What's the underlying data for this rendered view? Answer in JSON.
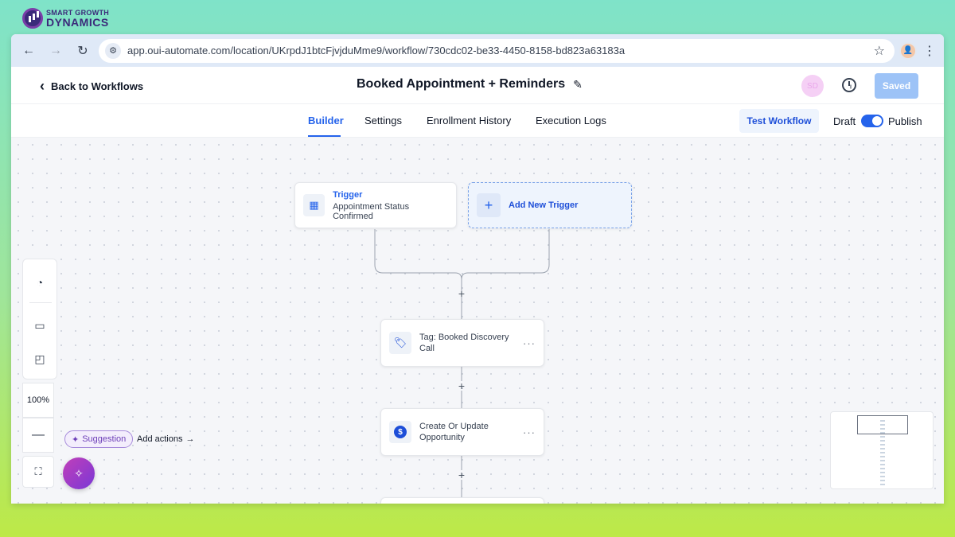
{
  "brand": {
    "top": "SMART GROWTH",
    "bottom": "DYNAMICS"
  },
  "browser": {
    "url": "app.oui-automate.com/location/UKrpdJ1btcFjvjduMme9/workflow/730cdc02-be33-4450-8158-bd823a63183a"
  },
  "header": {
    "back_label": "Back to Workflows",
    "title": "Booked Appointment + Reminders",
    "user_initials": "SD",
    "saved_label": "Saved"
  },
  "tabs": [
    {
      "label": "Builder",
      "active": true
    },
    {
      "label": "Settings",
      "active": false
    },
    {
      "label": "Enrollment History",
      "active": false
    },
    {
      "label": "Execution Logs",
      "active": false
    }
  ],
  "toolbar": {
    "test_label": "Test Workflow",
    "draft_label": "Draft",
    "publish_label": "Publish",
    "published_toggle": true
  },
  "canvas": {
    "trigger": {
      "title": "Trigger",
      "subtitle": "Appointment Status Confirmed"
    },
    "add_trigger_label": "Add New Trigger",
    "actions": [
      {
        "label": "Tag: Booked Discovery Call",
        "icon": "tag-icon"
      },
      {
        "label_line1": "Create Or Update",
        "label_line2": "Opportunity",
        "icon": "dollar-icon"
      }
    ],
    "plus": "+",
    "more": "···"
  },
  "side_panel": {
    "zoom": "100%",
    "minus": "—"
  },
  "suggestion": {
    "badge": "Suggestion",
    "action": "Add actions"
  },
  "colors": {
    "accent": "#2563eb",
    "saved_bg": "#9dc3f7",
    "ai_fab": "#a23cc8"
  }
}
